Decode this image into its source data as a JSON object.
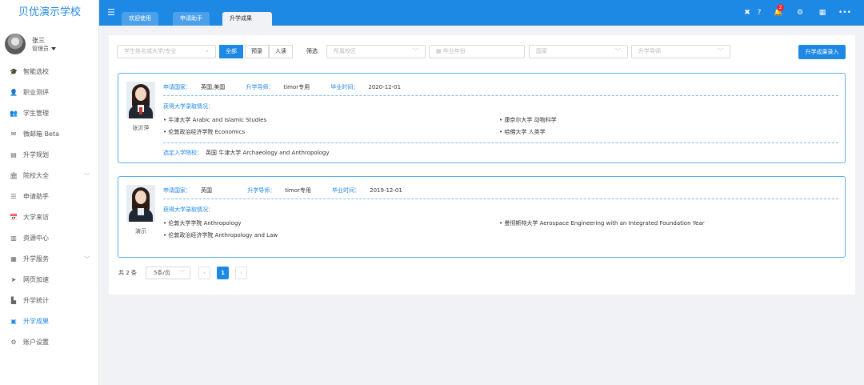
{
  "app": {
    "logo_text": "贝优演示学校"
  },
  "user": {
    "name": "张三",
    "role": "管理员"
  },
  "sidebar": {
    "items": [
      {
        "label": "智能选校",
        "icon": "graduation-cap-icon",
        "glyph": "🎓",
        "chev": ""
      },
      {
        "label": "职业测评",
        "icon": "person-icon",
        "glyph": "👤",
        "chev": ""
      },
      {
        "label": "学生管理",
        "icon": "users-icon",
        "glyph": "👥",
        "chev": ""
      },
      {
        "label": "微邮箱 Beta",
        "icon": "mail-icon",
        "glyph": "✉",
        "chev": ""
      },
      {
        "label": "升学规划",
        "icon": "plan-icon",
        "glyph": "▤",
        "chev": ""
      },
      {
        "label": "院校大全",
        "icon": "institution-icon",
        "glyph": "🏛",
        "chev": "﹀"
      },
      {
        "label": "申请助手",
        "icon": "list-icon",
        "glyph": "☰",
        "chev": ""
      },
      {
        "label": "大学来访",
        "icon": "calendar-icon",
        "glyph": "📅",
        "chev": ""
      },
      {
        "label": "资源中心",
        "icon": "library-icon",
        "glyph": "▥",
        "chev": ""
      },
      {
        "label": "升学服务",
        "icon": "grid-icon",
        "glyph": "▦",
        "chev": "﹀"
      },
      {
        "label": "网页加速",
        "icon": "send-icon",
        "glyph": "➤",
        "chev": ""
      },
      {
        "label": "升学统计",
        "icon": "bar-chart-icon",
        "glyph": "▙",
        "chev": ""
      },
      {
        "label": "升学成果",
        "icon": "id-card-icon",
        "glyph": "▣",
        "chev": "",
        "active": true
      },
      {
        "label": "账户设置",
        "icon": "gear-icon",
        "glyph": "⚙",
        "chev": ""
      }
    ]
  },
  "topbar": {
    "tabs": [
      {
        "label": "欢迎使用",
        "active": false
      },
      {
        "label": "申请助手",
        "active": false
      },
      {
        "label": "升学成果",
        "active": true
      }
    ],
    "notification_count": "2"
  },
  "filters": {
    "search_placeholder": "学生姓名或大学/专业",
    "seg_all": "全部",
    "seg_pre": "预录",
    "seg_enrolled": "入读",
    "filter_label": "筛选",
    "campus_placeholder": "所属校区",
    "grad_year_placeholder": "毕业年份",
    "country_placeholder": "国家",
    "advisor_placeholder": "升学导师",
    "entry_button": "升学成果录入"
  },
  "labels": {
    "country": "申请国家：",
    "advisor": "升学导师：",
    "grad": "毕业时间：",
    "offers": "获得大学录取情况：",
    "chosen": "选定入学院校："
  },
  "records": [
    {
      "name": "张沂萍",
      "country": "英国,美国",
      "advisor": "timor专用",
      "grad_date": "2020-12-01",
      "offers_left": [
        "• 牛津大学 Arabic and Islamic Studies",
        "• 伦敦政治经济学院 Economics"
      ],
      "offers_right": [
        "• 康奈尔大学 动物科学",
        "• 哈佛大学 人类学"
      ],
      "chosen": "英国 牛津大学 Archaeology and Anthropology"
    },
    {
      "name": "演示",
      "country": "英国",
      "advisor": "timor专用",
      "grad_date": "2019-12-01",
      "offers_left": [
        "• 伦敦大学学院 Anthropology",
        "• 伦敦政治经济学院 Anthropology and Law"
      ],
      "offers_right": [
        "• 曼彻斯特大学 Aerospace Engineering with an Integrated Foundation Year"
      ],
      "chosen": ""
    }
  ],
  "pagination": {
    "total": "共 2 条",
    "page_size": "5条/页",
    "current_page": "1"
  }
}
